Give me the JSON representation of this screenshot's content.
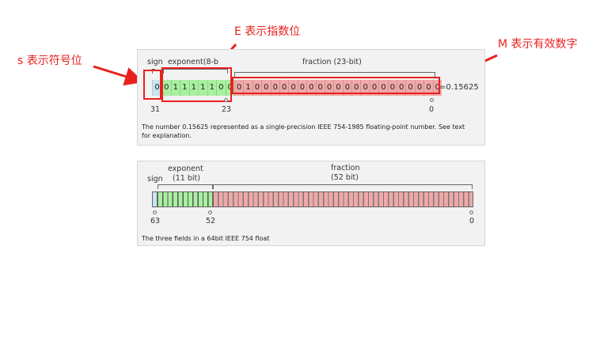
{
  "annotations": {
    "s": "s 表示符号位",
    "e": "E 表示指数位",
    "m": "M 表示有效数字"
  },
  "single": {
    "sign_label": "sign",
    "exponent_label": "exponent(8-b",
    "fraction_label": "fraction (23-bit)",
    "sign_bit": "0",
    "exponent_bits": [
      "0",
      "1",
      "1",
      "1",
      "1",
      "1",
      "0",
      "0"
    ],
    "fraction_bits": [
      "0",
      "1",
      "0",
      "0",
      "0",
      "0",
      "0",
      "0",
      "0",
      "0",
      "0",
      "0",
      "0",
      "0",
      "0",
      "0",
      "0",
      "0",
      "0",
      "0",
      "0",
      "0",
      "0"
    ],
    "value": "=0.15625",
    "ticks": [
      "31",
      "23",
      "0"
    ],
    "caption": "The number 0.15625 represented as a single-precision IEEE 754-1985 floating-point number. See text for explanation."
  },
  "double": {
    "sign_label": "sign",
    "exponent_label": "exponent",
    "exponent_sub": "(11 bit)",
    "fraction_label": "fraction",
    "fraction_sub": "(52 bit)",
    "ticks": [
      "63",
      "52",
      "0"
    ],
    "caption": "The three fields in a 64bit IEEE 754 float"
  },
  "colors": {
    "sign": "#c7e6ef",
    "exponent": "#a8f0a0",
    "fraction": "#f0a8a8",
    "annotation": "#e8211f"
  }
}
